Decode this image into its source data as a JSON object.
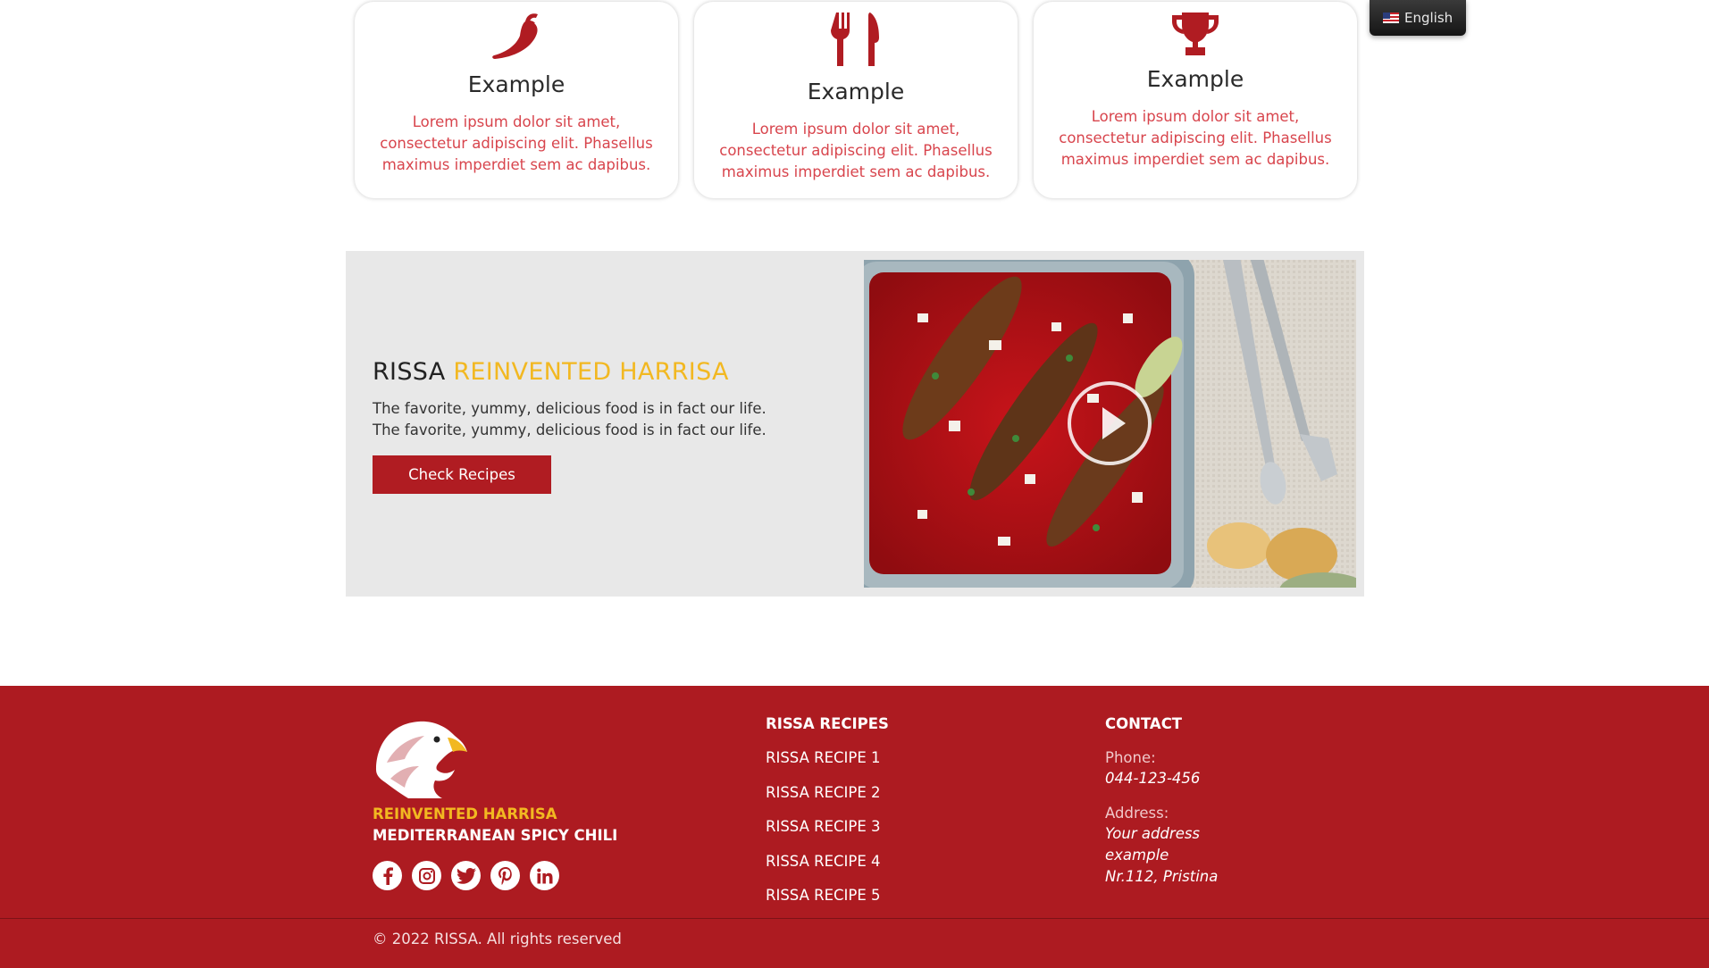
{
  "language_switcher": {
    "label": "English",
    "flag": "us-flag-icon"
  },
  "cards": [
    {
      "icon": "chili-pepper-icon",
      "title": "Example",
      "text": "Lorem ipsum dolor sit amet, consectetur adipiscing elit. Phasellus maximus imperdiet sem ac dapibus."
    },
    {
      "icon": "fork-knife-icon",
      "title": "Example",
      "text": "Lorem ipsum dolor sit amet, consectetur adipiscing elit. Phasellus maximus imperdiet sem ac dapibus."
    },
    {
      "icon": "trophy-icon",
      "title": "Example",
      "text": "Lorem ipsum dolor sit amet, consectetur adipiscing elit. Phasellus maximus imperdiet sem ac dapibus."
    }
  ],
  "promo": {
    "heading_dark": "RISSA",
    "heading_accent": "REINVENTED HARRISA",
    "text": "The favorite, yummy, delicious food is in fact our life. The favorite, yummy, delicious food is in fact our life.",
    "button_label": "Check Recipes",
    "media": "video-thumbnail with play-icon"
  },
  "footer": {
    "tagline_1": "REINVENTED HARRISA",
    "tagline_2": "MEDITERRANEAN SPICY CHILI",
    "socials": [
      "facebook-icon",
      "instagram-icon",
      "twitter-icon",
      "pinterest-icon",
      "linkedin-icon"
    ],
    "recipes_title": "RISSA RECIPES",
    "recipes": [
      "RISSA RECIPE 1",
      "RISSA RECIPE 2",
      "RISSA RECIPE 3",
      "RISSA RECIPE 4",
      "RISSA RECIPE 5"
    ],
    "contact_title": "CONTACT",
    "phone_label": "Phone:",
    "phone_value": "044-123-456",
    "address_label": "Address:",
    "address_line_1": "Your address",
    "address_line_2": "example",
    "address_line_3": "Nr.112, Pristina",
    "copyright": "© 2022 RISSA. All rights reserved"
  },
  "colors": {
    "brand_red": "#ad1b21",
    "accent_yellow": "#f2b821",
    "card_text_red": "#d8454d",
    "promo_bg": "#e8e8e8"
  }
}
